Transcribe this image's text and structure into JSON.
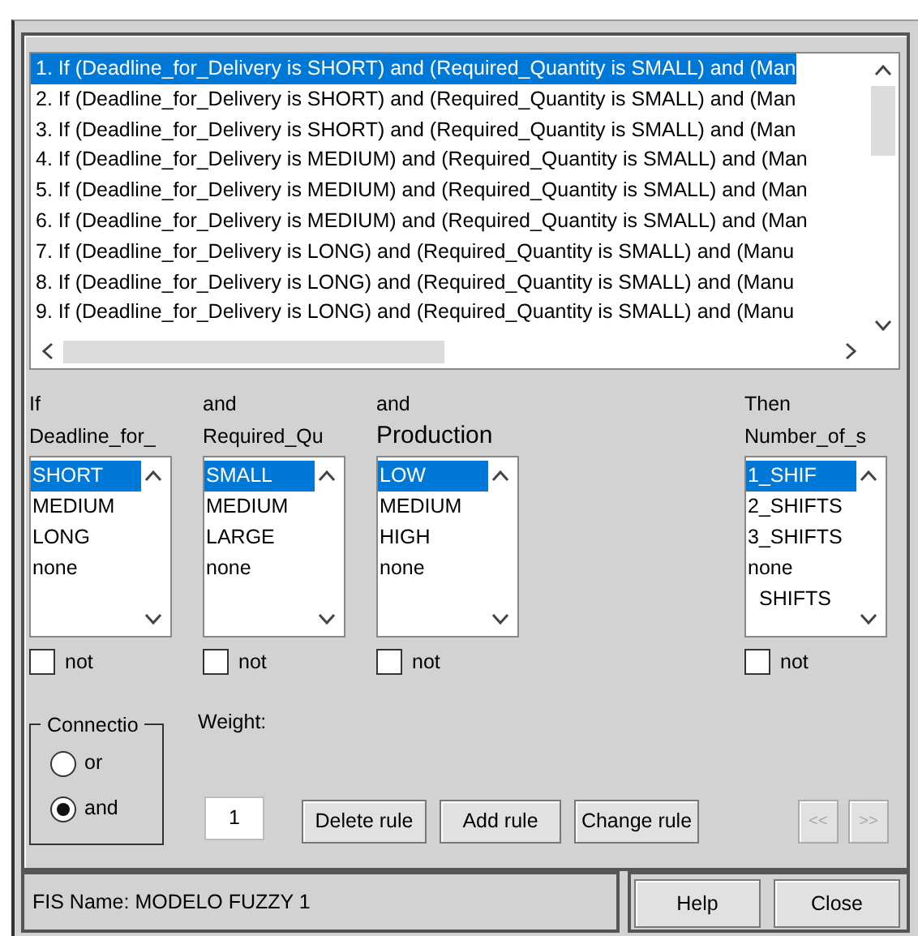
{
  "rules": {
    "items": [
      {
        "text": "1. If (Deadline_for_Delivery is SHORT) and (Required_Quantity is SMALL) and (Man",
        "selected": true
      },
      {
        "text": "2. If (Deadline_for_Delivery is SHORT) and (Required_Quantity is SMALL) and (Man",
        "selected": false
      },
      {
        "text": "3. If (Deadline_for_Delivery is SHORT) and (Required_Quantity is SMALL) and (Man",
        "selected": false
      },
      {
        "text": "4. If (Deadline_for_Delivery is MEDIUM) and (Required_Quantity is SMALL) and (Man",
        "selected": false
      },
      {
        "text": "5. If (Deadline_for_Delivery is MEDIUM) and (Required_Quantity is SMALL) and (Man",
        "selected": false
      },
      {
        "text": "6. If (Deadline_for_Delivery is MEDIUM) and (Required_Quantity is SMALL) and (Man",
        "selected": false
      },
      {
        "text": "7. If (Deadline_for_Delivery is LONG) and (Required_Quantity is SMALL) and (Manu",
        "selected": false
      },
      {
        "text": "8. If (Deadline_for_Delivery is LONG) and (Required_Quantity is SMALL) and (Manu",
        "selected": false
      },
      {
        "text": "9. If (Deadline_for_Delivery is LONG) and (Required_Quantity is SMALL) and (Manu",
        "selected": false
      }
    ]
  },
  "antecedents": [
    {
      "connector": "If",
      "variable": "Deadline_for_",
      "not": {
        "label": "not",
        "checked": false
      },
      "items": [
        {
          "label": "SHORT",
          "selected": true
        },
        {
          "label": "MEDIUM",
          "selected": false
        },
        {
          "label": "LONG",
          "selected": false
        },
        {
          "label": "none",
          "selected": false
        }
      ]
    },
    {
      "connector": "and",
      "variable": "Required_Qu",
      "not": {
        "label": "not",
        "checked": false
      },
      "items": [
        {
          "label": "SMALL",
          "selected": true
        },
        {
          "label": "MEDIUM",
          "selected": false
        },
        {
          "label": "LARGE",
          "selected": false
        },
        {
          "label": "none",
          "selected": false
        }
      ]
    },
    {
      "connector": "and",
      "variable": "Production",
      "not": {
        "label": "not",
        "checked": false
      },
      "items": [
        {
          "label": "LOW",
          "selected": true
        },
        {
          "label": "MEDIUM",
          "selected": false
        },
        {
          "label": "HIGH",
          "selected": false
        },
        {
          "label": "none",
          "selected": false
        }
      ]
    }
  ],
  "consequent": {
    "connector": "Then",
    "variable": "Number_of_s",
    "not": {
      "label": "not",
      "checked": false
    },
    "items": [
      {
        "label": "1_SHIF",
        "selected": true
      },
      {
        "label": "2_SHIFTS",
        "selected": false
      },
      {
        "label": "3_SHIFTS",
        "selected": false
      },
      {
        "label": "none",
        "selected": false
      },
      {
        "label": "SHIFTS",
        "selected": false
      }
    ]
  },
  "connection": {
    "title": "Connectio",
    "options": [
      {
        "label": "or",
        "selected": false
      },
      {
        "label": "and",
        "selected": true
      }
    ]
  },
  "weight": {
    "label": "Weight:",
    "value": "1"
  },
  "rule_buttons": [
    {
      "label": "Delete rule",
      "disabled": false
    },
    {
      "label": "Add rule",
      "disabled": false
    },
    {
      "label": "Change rule",
      "disabled": false
    }
  ],
  "nav_buttons": [
    {
      "label": "<<",
      "disabled": true
    },
    {
      "label": ">>",
      "disabled": true
    }
  ],
  "status": "FIS Name: MODELO FUZZY 1",
  "footer_buttons": [
    {
      "label": "Help"
    },
    {
      "label": "Close"
    }
  ]
}
